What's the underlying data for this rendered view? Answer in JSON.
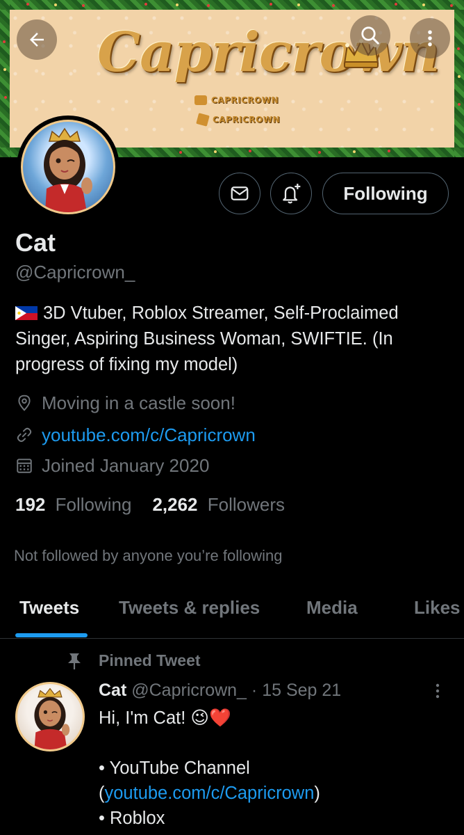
{
  "banner": {
    "title": "Capricrown",
    "sub_youtube": "CAPRICROWN",
    "sub_roblox": "CAPRICROWN"
  },
  "nav": {
    "back_icon": "arrow-left-icon",
    "search_icon": "search-icon",
    "more_icon": "more-vertical-icon"
  },
  "actions": {
    "following_label": "Following"
  },
  "profile": {
    "name": "Cat",
    "handle": "@Capricrown_",
    "bio": "3D Vtuber, Roblox Streamer, Self-Proclaimed Singer, Aspiring Business Woman, SWIFTIE. (In progress of fixing my model)",
    "location": "Moving in a castle soon!",
    "website": "youtube.com/c/Capricrown",
    "joined": "Joined January 2020",
    "following_count": "192",
    "following_label": "Following",
    "followers_count": "2,262",
    "followers_label": "Followers",
    "not_followed": "Not followed by anyone you’re following"
  },
  "tabs": [
    "Tweets",
    "Tweets & replies",
    "Media",
    "Likes"
  ],
  "pinned": {
    "label": "Pinned Tweet",
    "name": "Cat",
    "handle": "@Capricrown_",
    "date": "· 15 Sep 21",
    "line1": "Hi, I'm Cat! 😉❤️",
    "line2": "• YouTube Channel",
    "line3_open": "(",
    "line3_link": "youtube.com/c/Capricrown",
    "line3_close": ")",
    "line4": "• Roblox"
  },
  "colors": {
    "accent": "#1d9bf0",
    "muted": "#71767b",
    "text": "#e7e9ea",
    "background": "#000000"
  }
}
